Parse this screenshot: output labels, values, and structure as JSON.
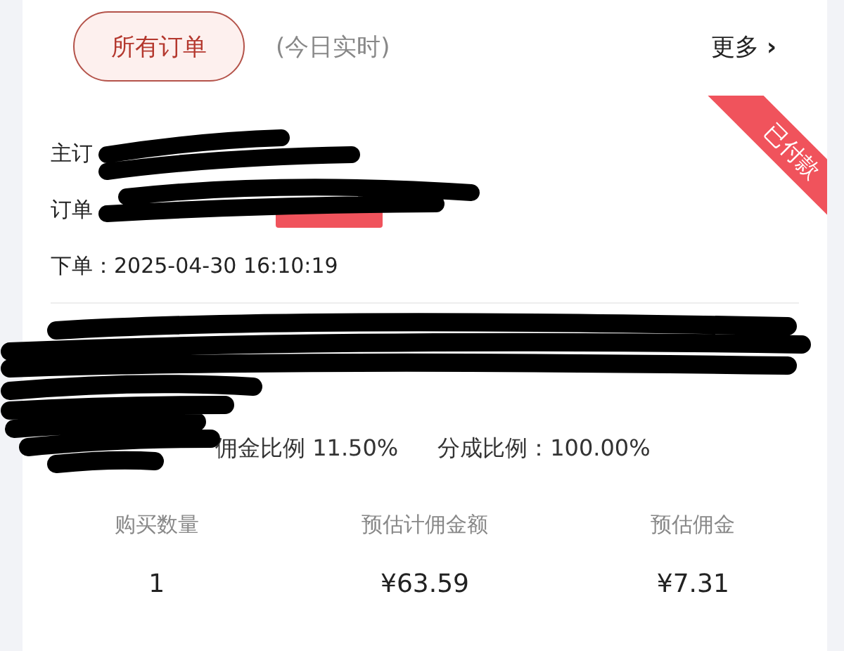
{
  "header": {
    "tabs": [
      {
        "label": "所有订单",
        "selected": true
      }
    ],
    "note": "(今日实时)",
    "more": "更多",
    "more_icon": "›"
  },
  "order": {
    "status_ribbon": "已付款",
    "main_order_label": "主订",
    "order_no_label": "订单",
    "placed": "下单：2025-04-30 16:10:19",
    "commission_rate": "佣金比例 11.50%",
    "share_rate": "分成比例：100.00%",
    "stats": [
      {
        "label": "购买数量",
        "value": "1"
      },
      {
        "label": "预估计佣金额",
        "value": "¥63.59"
      },
      {
        "label": "预估佣金",
        "value": "¥7.31"
      }
    ]
  }
}
